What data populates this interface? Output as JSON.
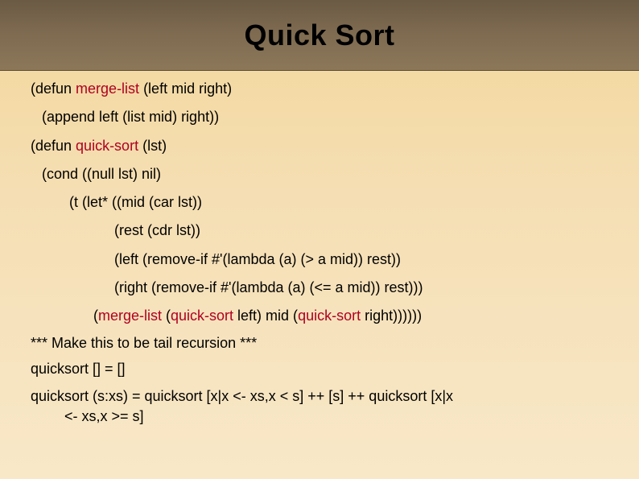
{
  "title": "Quick Sort",
  "lines": {
    "l1_pre": "(defun ",
    "l1_kw": "merge-list",
    "l1_post": " (left mid right)",
    "l2": "(append left (list mid) right))",
    "l3_pre": "(defun ",
    "l3_kw": "quick-sort",
    "l3_post": " (lst)",
    "l4": "(cond ((null lst) nil)",
    "l5": "(t (let* ((mid (car lst))",
    "l6": "(rest (cdr lst))",
    "l7": "(left (remove-if #'(lambda (a) (> a mid)) rest))",
    "l8": "(right (remove-if #'(lambda (a) (<= a mid)) rest)))",
    "l9_pre": "(",
    "l9_kw1": "merge-list",
    "l9_mid1": " (",
    "l9_kw2": "quick-sort",
    "l9_mid2": " left) mid (",
    "l9_kw3": "quick-sort",
    "l9_post": " right))))))"
  },
  "note": "*** Make this to be tail recursion ***",
  "haskell": {
    "h1": "quicksort [] = []",
    "h2a": "quicksort (s:xs) = quicksort [x|x <- xs,x < s] ++ [s] ++ quicksort [x|x",
    "h2b": "<- xs,x >= s]"
  }
}
